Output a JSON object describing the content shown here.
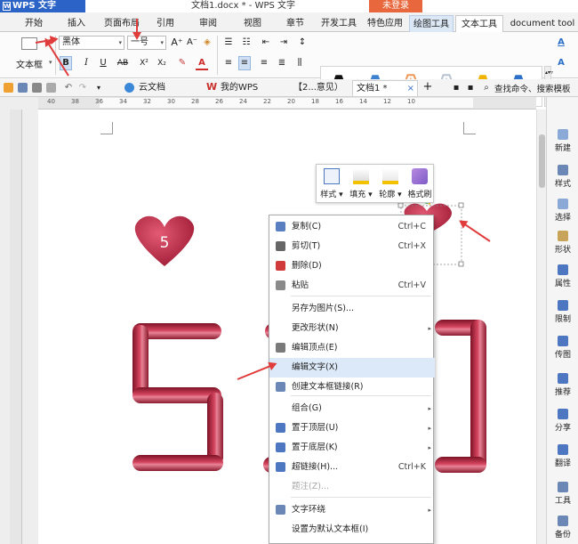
{
  "app": {
    "name": "WPS 文字",
    "icon": "w-logo-icon"
  },
  "title": "文档1.docx * - WPS 文字",
  "login_button": "未登录",
  "menu_tabs": [
    "开始",
    "插入",
    "页面布局",
    "引用",
    "审阅",
    "视图",
    "章节",
    "开发工具",
    "特色应用",
    "绘图工具",
    "文本工具",
    "document tool"
  ],
  "ribbon": {
    "textbox_label": "文本框",
    "font_name": "黑体",
    "font_size": "一号",
    "bold": "B",
    "italic": "I",
    "underline": "U",
    "strike": "AB",
    "superscript": "X²",
    "subscript": "X₂",
    "font_color_letter": "A",
    "art_letter": "A",
    "art_colors": [
      "#111111",
      "#3d82d2",
      "#ee9a5a",
      "#b7c3d2",
      "#f0b400",
      "#2c70c9"
    ]
  },
  "quick_tabs": [
    {
      "label": "云文档"
    },
    {
      "label": "我的WPS"
    },
    {
      "label": "【2...意见）"
    },
    {
      "label": "文档1 *"
    }
  ],
  "quick_add": "+",
  "search_label": "查找命令、搜索模板",
  "ruler_ticks": [
    "40",
    "38",
    "36",
    "34",
    "32",
    "30",
    "28",
    "26",
    "24",
    "22",
    "20",
    "18",
    "16",
    "14",
    "12",
    "10"
  ],
  "sidebar": [
    {
      "label": "新建",
      "icon": "new-icon"
    },
    {
      "label": "样式",
      "icon": "style-icon"
    },
    {
      "label": "选择",
      "icon": "select-icon"
    },
    {
      "label": "形状",
      "icon": "shape-icon"
    },
    {
      "label": "属性",
      "icon": "properties-icon"
    },
    {
      "label": "限制",
      "icon": "restrict-icon"
    },
    {
      "label": "传图",
      "icon": "upload-image-icon"
    },
    {
      "label": "推荐",
      "icon": "recommend-icon"
    },
    {
      "label": "分享",
      "icon": "share-icon"
    },
    {
      "label": "翻译",
      "icon": "translate-icon"
    },
    {
      "label": "工具",
      "icon": "tools-icon"
    },
    {
      "label": "备份",
      "icon": "backup-icon"
    }
  ],
  "mini_toolbar": [
    {
      "label": "样式 ▾",
      "icon": "style-brush-icon"
    },
    {
      "label": "填充 ▾",
      "icon": "fill-bucket-icon"
    },
    {
      "label": "轮廓 ▾",
      "icon": "outline-pen-icon"
    },
    {
      "label": "格式刷",
      "icon": "format-painter-icon"
    }
  ],
  "heart_number": "5",
  "artwork_digits": "520",
  "context_menu": [
    {
      "label": "复制(C)",
      "shortcut": "Ctrl+C",
      "icon": "copy-icon"
    },
    {
      "label": "剪切(T)",
      "shortcut": "Ctrl+X",
      "icon": "cut-icon"
    },
    {
      "label": "删除(D)",
      "shortcut": "",
      "icon": "delete-icon"
    },
    {
      "label": "粘贴",
      "shortcut": "Ctrl+V",
      "icon": "paste-icon"
    },
    {
      "label": "另存为图片(S)...",
      "shortcut": "",
      "icon": ""
    },
    {
      "label": "更改形状(N)",
      "shortcut": "",
      "icon": "",
      "submenu": true
    },
    {
      "label": "编辑顶点(E)",
      "shortcut": "",
      "icon": "edit-points-icon"
    },
    {
      "label": "编辑文字(X)",
      "shortcut": "",
      "icon": "",
      "highlighted": true
    },
    {
      "label": "创建文本框链接(R)",
      "shortcut": "",
      "icon": "link-textbox-icon"
    },
    {
      "label": "组合(G)",
      "shortcut": "",
      "icon": "",
      "submenu": true
    },
    {
      "label": "置于顶层(U)",
      "shortcut": "",
      "icon": "bring-front-icon",
      "submenu": true
    },
    {
      "label": "置于底层(K)",
      "shortcut": "",
      "icon": "send-back-icon",
      "submenu": true
    },
    {
      "label": "超链接(H)...",
      "shortcut": "Ctrl+K",
      "icon": "hyperlink-icon"
    },
    {
      "label": "题注(Z)...",
      "shortcut": "",
      "icon": "",
      "disabled": true
    },
    {
      "label": "文字环绕",
      "shortcut": "",
      "icon": "text-wrap-icon",
      "submenu": true
    },
    {
      "label": "设置为默认文本框(I)",
      "shortcut": "",
      "icon": ""
    }
  ],
  "colors": {
    "accent": "#2b63c6",
    "heart": "#c8304a",
    "digits": "#b8283f",
    "annotation_arrow": "#e03c3c"
  }
}
